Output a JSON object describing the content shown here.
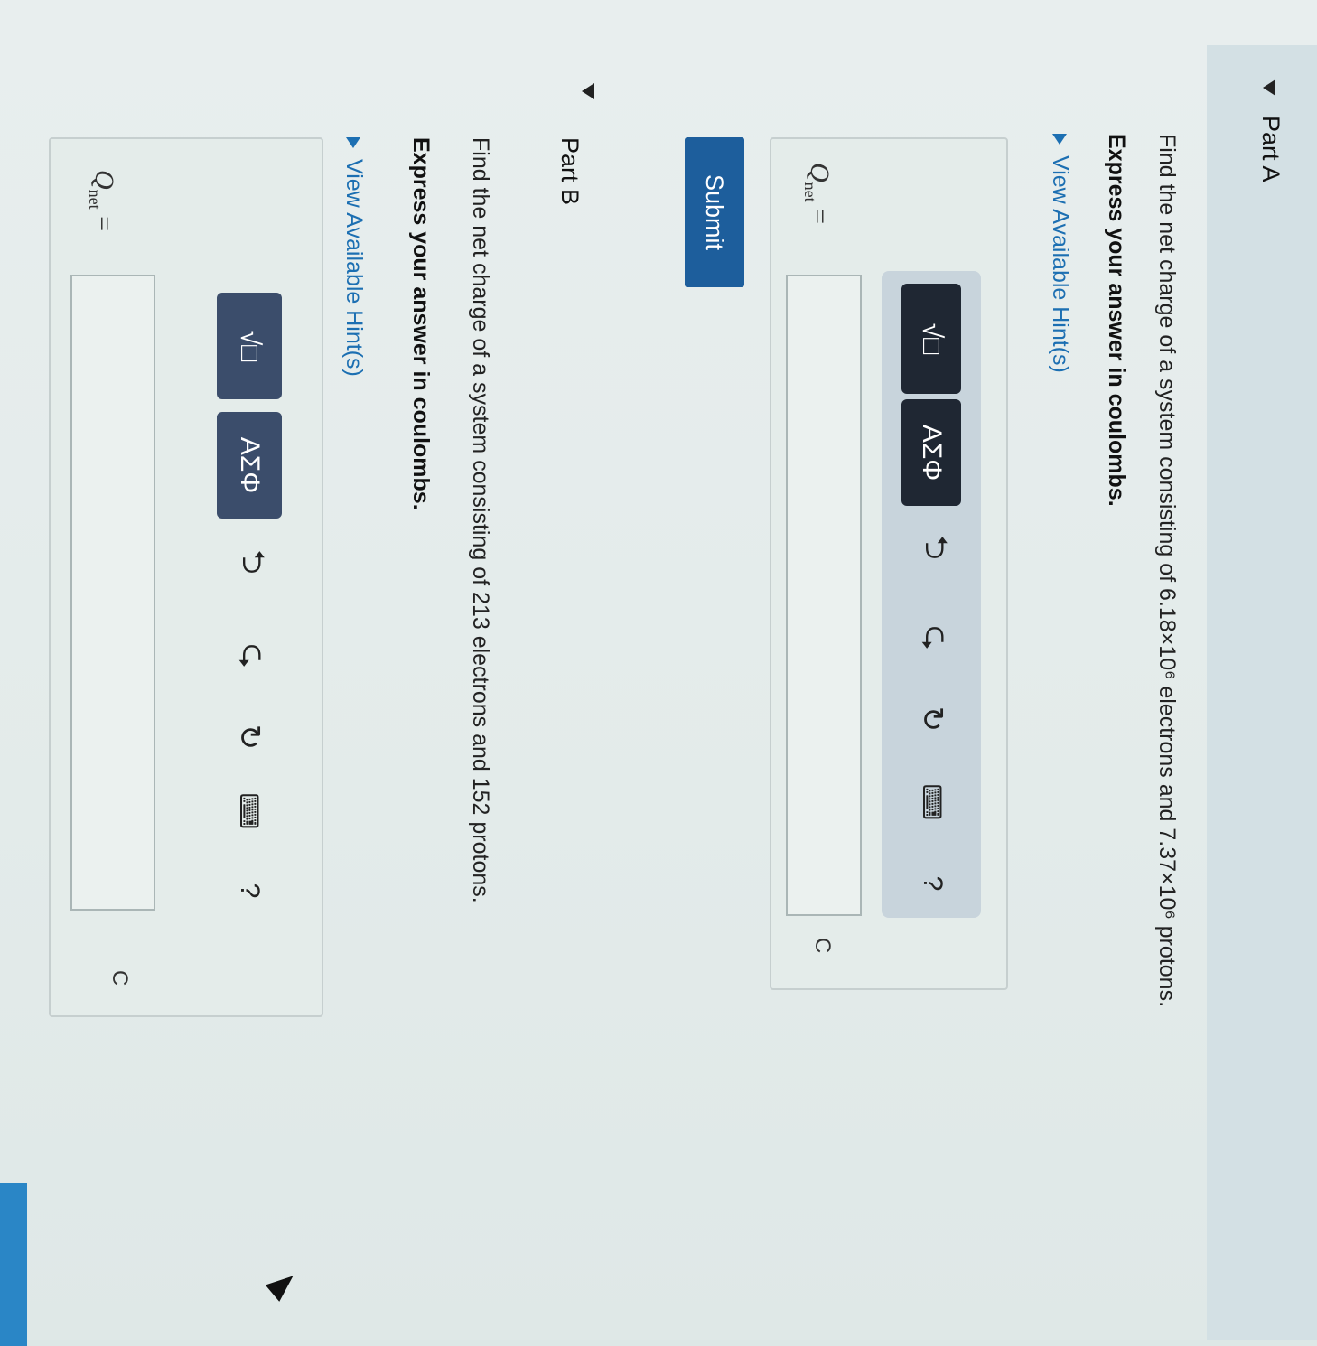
{
  "part_a": {
    "title": "Part A",
    "question": "Find the net charge of a system consisting of 6.18×10⁶ electrons and 7.37×10⁶ protons.",
    "instruction": "Express your answer in coulombs.",
    "hint_label": "View Available Hint(s)",
    "answer": {
      "variable": "Q",
      "subscript": "net",
      "equals": "=",
      "input_value": "",
      "unit": "C"
    },
    "submit_label": "Submit"
  },
  "part_b": {
    "title": "Part B",
    "question": "Find the net charge of a system consisting of 213 electrons and 152 protons.",
    "instruction": "Express your answer in coulombs.",
    "hint_label": "View Available Hint(s)",
    "answer": {
      "variable": "Q",
      "subscript": "net",
      "equals": "=",
      "input_value": "",
      "unit": "C"
    }
  },
  "toolbar": {
    "template_icon": "√□",
    "greek_label": "ΑΣΦ",
    "undo_icon": "undo-icon",
    "redo_icon": "redo-icon",
    "reset_icon": "reset-icon",
    "keyboard_icon": "keyboard-icon",
    "help_label": "?"
  },
  "colors": {
    "toolbar_a_bg": "#c8d4dc",
    "toolbar_a_btn": "#1f2733",
    "toolbar_b_btn": "#3b4d6b",
    "hint_link": "#1c6fb2",
    "submit_bg": "#1d5e9c"
  }
}
